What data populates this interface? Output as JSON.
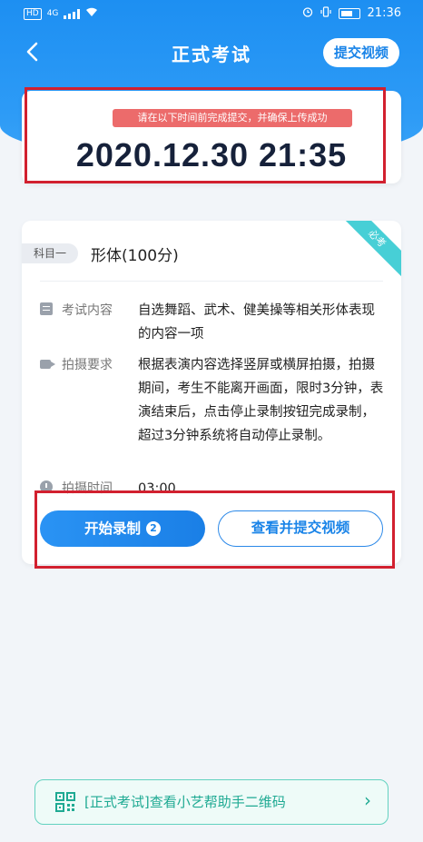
{
  "statusbar": {
    "chip": "HD",
    "net": "4G",
    "time": "21:36"
  },
  "nav": {
    "back": "‹",
    "title": "正式考试",
    "submit_video": "提交视频"
  },
  "deadline": {
    "hint": "请在以下时间前完成提交，并确保上传成功",
    "time": "2020.12.30 21:35"
  },
  "subject": {
    "ribbon": "必考",
    "tag": "科目一",
    "name": "形体(100分)",
    "rows": [
      {
        "label": "考试内容",
        "value": "自选舞蹈、武术、健美操等相关形体表现的内容一项",
        "icon": "document-icon"
      },
      {
        "label": "拍摄要求",
        "value": "根据表演内容选择竖屏或横屏拍摄，拍摄期间，考生不能离开画面，限时3分钟，表演结束后，点击停止录制按钮完成录制，超过3分钟系统将自动停止录制。",
        "icon": "camera-icon"
      },
      {
        "label": "拍摄时间",
        "value": "03:00",
        "icon": "clock-icon"
      }
    ]
  },
  "actions": {
    "start_label": "开始录制",
    "start_count": "2",
    "review_label": "查看并提交视频"
  },
  "qr": {
    "text": "[正式考试]查看小艺帮助手二维码",
    "chevron": "›"
  },
  "colors": {
    "primary": "#1a84e8",
    "highlight": "#d2202f",
    "ribbon": "#47cfd6",
    "qr": "#1faa93"
  }
}
